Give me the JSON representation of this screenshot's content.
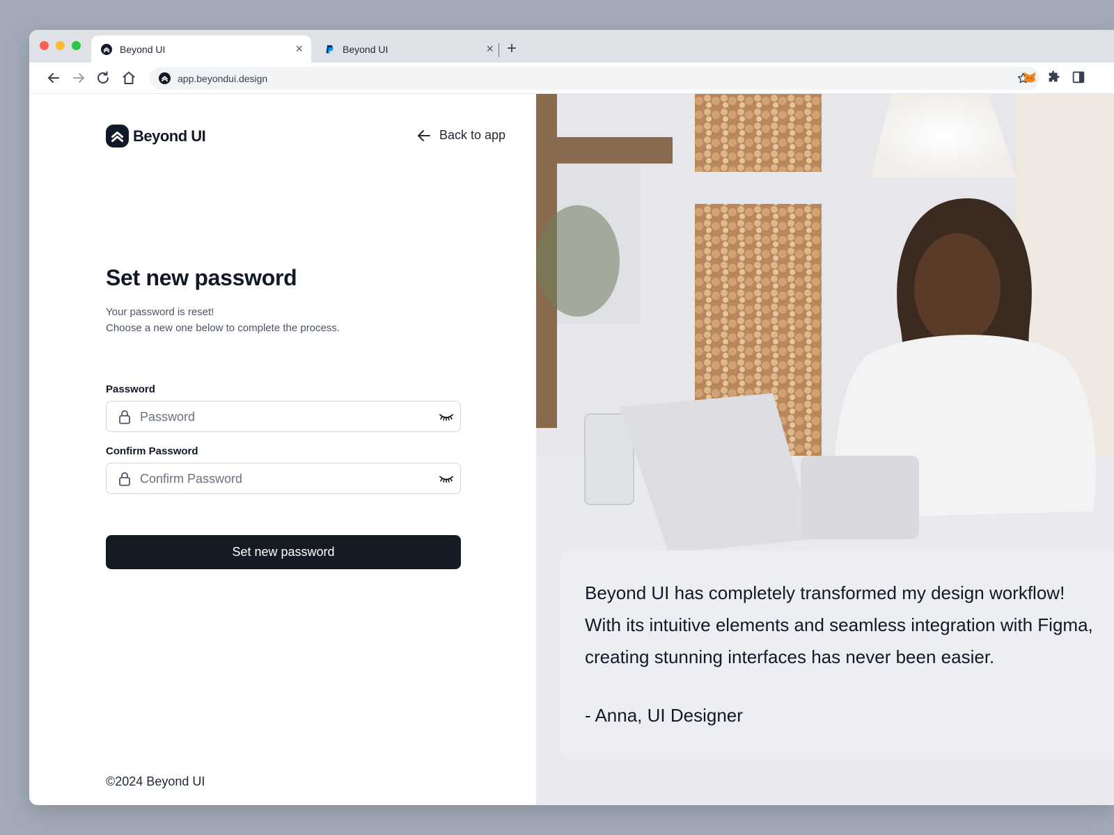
{
  "browser": {
    "tabs": [
      {
        "title": "Beyond UI",
        "active": true,
        "favicon": "beyond-ui-logo"
      },
      {
        "title": "Beyond UI",
        "active": false,
        "favicon": "paypal-logo"
      }
    ],
    "url": "app.beyondui.design",
    "traffic_lights": {
      "close": "#ff5f57",
      "minimize": "#febc2e",
      "maximize": "#28c840"
    }
  },
  "brand": {
    "name": "Beyond UI"
  },
  "header": {
    "back_label": "Back to app"
  },
  "form": {
    "title": "Set new password",
    "subtitle_line1": "Your password is reset!",
    "subtitle_line2": "Choose a new one below to complete the process.",
    "password": {
      "label": "Password",
      "placeholder": "Password",
      "value": ""
    },
    "confirm": {
      "label": "Confirm Password",
      "placeholder": "Confirm Password",
      "value": ""
    },
    "submit_label": "Set new password"
  },
  "footer": {
    "copyright": "©2024 Beyond UI"
  },
  "testimonial": {
    "quote": "Beyond UI has completely transformed my design workflow! With its intuitive elements and seamless integration with Figma, creating stunning interfaces has never been easier.",
    "author": "- Anna, UI Designer"
  },
  "colors": {
    "primary_button": "#141b25",
    "page_background": "#a3aab7"
  }
}
